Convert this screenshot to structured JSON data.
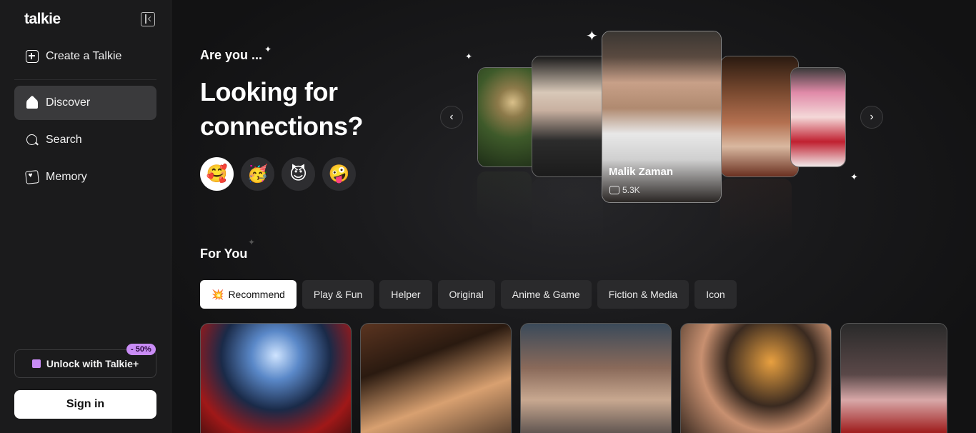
{
  "app": {
    "name": "talkie"
  },
  "sidebar": {
    "create_label": "Create a Talkie",
    "items": [
      {
        "label": "Discover",
        "icon": "home-icon",
        "active": true
      },
      {
        "label": "Search",
        "icon": "search-icon"
      },
      {
        "label": "Memory",
        "icon": "memory-icon"
      }
    ],
    "unlock_label": "Unlock with Talkie+",
    "discount_badge": "- 50%",
    "signin_label": "Sign in"
  },
  "hero": {
    "eyebrow": "Are you ...",
    "headline": "Looking for connections?",
    "moods": [
      "🥰",
      "🥳",
      "😈",
      "🤪"
    ]
  },
  "carousel": {
    "featured_name": "Malik Zaman",
    "featured_count": "5.3K"
  },
  "for_you": {
    "title": "For You",
    "tabs": [
      {
        "label": "Recommend",
        "icon": "💥",
        "active": true
      },
      {
        "label": "Play & Fun"
      },
      {
        "label": "Helper"
      },
      {
        "label": "Original"
      },
      {
        "label": "Anime & Game"
      },
      {
        "label": "Fiction & Media"
      },
      {
        "label": "Icon"
      }
    ]
  },
  "colors": {
    "accent": "#c98cf5",
    "sidebar_bg": "#1b1b1c",
    "main_bg": "#141414"
  }
}
